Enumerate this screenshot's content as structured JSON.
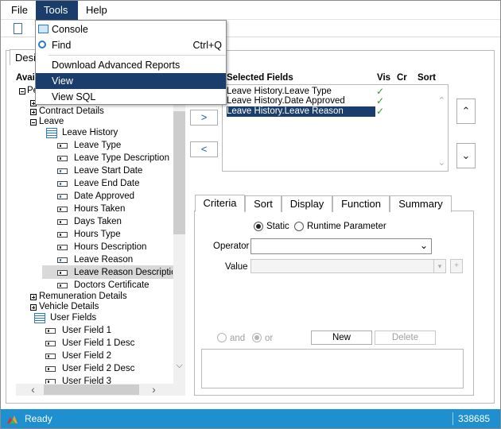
{
  "menubar": {
    "items": [
      {
        "label": "File"
      },
      {
        "label": "Tools"
      },
      {
        "label": "Help"
      }
    ]
  },
  "tools_menu": {
    "items": [
      {
        "label": "Console",
        "icon": "console-icon"
      },
      {
        "label": "Find",
        "shortcut": "Ctrl+Q",
        "icon": "find-icon"
      },
      {
        "label": "Download Advanced Reports"
      },
      {
        "label": "View"
      },
      {
        "label": "View SQL"
      }
    ]
  },
  "main_tab": {
    "label": "Desi"
  },
  "available": {
    "header": "Avai"
  },
  "tree": {
    "root_label": "Pe",
    "contract": "Contract Details",
    "leave": "Leave",
    "leave_history": "Leave History",
    "leave_fields": [
      "Leave Type",
      "Leave Type Description",
      "Leave Start Date",
      "Leave End Date",
      "Date Approved",
      "Hours Taken",
      "Days Taken",
      "Hours Type",
      "Hours Description",
      "Leave Reason",
      "Leave Reason Descriptio",
      "Doctors Certificate"
    ],
    "remuneration": "Remuneration Details",
    "vehicle": "Vehicle Details",
    "user_fields": "User Fields",
    "user_field_items": [
      "User Field 1",
      "User Field 1 Desc",
      "User Field 2",
      "User Field 2 Desc",
      "User Field 3"
    ]
  },
  "move_buttons": {
    "add": ">",
    "remove": "<"
  },
  "selected": {
    "header": "Selected Fields",
    "col_vis": "Vis",
    "col_cr": "Cr",
    "col_sort": "Sort",
    "rows": [
      {
        "label": "Leave History.Leave Type",
        "vis": "✓"
      },
      {
        "label": "Leave History.Date Approved",
        "vis": "✓"
      },
      {
        "label": "Leave History.Leave Reason",
        "vis": "✓"
      }
    ]
  },
  "criteria": {
    "tabs": [
      {
        "label": "Criteria"
      },
      {
        "label": "Sort"
      },
      {
        "label": "Display"
      },
      {
        "label": "Function"
      },
      {
        "label": "Summary"
      }
    ],
    "static_label": "Static",
    "runtime_label": "Runtime Parameter",
    "operator_label": "Operator",
    "operator_value": "",
    "value_label": "Value",
    "value_value": "",
    "and_label": "and",
    "or_label": "or",
    "new_button": "New",
    "delete_button": "Delete"
  },
  "status": {
    "text": "Ready",
    "count": "338685"
  },
  "colors": {
    "accent": "#1a3d6b",
    "status_bar": "#1e8fcf",
    "check": "#2a9a2a"
  }
}
